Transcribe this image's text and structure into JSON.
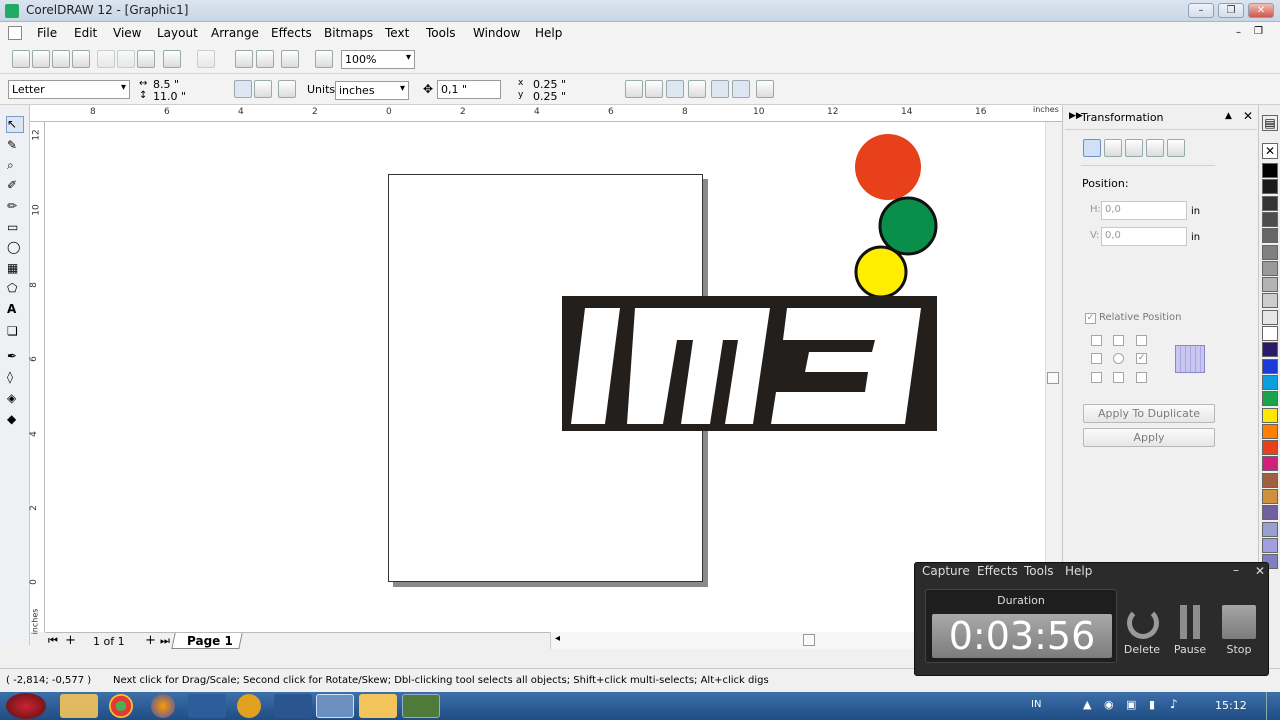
{
  "window": {
    "title": "CorelDRAW 12 - [Graphic1]"
  },
  "menubar": {
    "items": [
      "File",
      "Edit",
      "View",
      "Layout",
      "Arrange",
      "Effects",
      "Bitmaps",
      "Text",
      "Tools",
      "Window",
      "Help"
    ]
  },
  "toolbar1": {
    "zoom_value": "100%"
  },
  "property_bar": {
    "paper_type": "Letter",
    "page_width": "8.5 \"",
    "page_height": "11.0 \"",
    "units_label": "Units:",
    "units_value": "inches",
    "nudge_value": "0,1 \"",
    "duplicate_x": "0.25 \"",
    "duplicate_y": "0.25 \""
  },
  "rulers": {
    "top_labels": [
      "8",
      "6",
      "4",
      "2",
      "0",
      "2",
      "4",
      "6",
      "8",
      "10",
      "12",
      "14",
      "16"
    ],
    "top_unit": "inches",
    "left_labels": [
      "12",
      "10",
      "8",
      "6",
      "4",
      "2",
      "0"
    ],
    "left_unit": "inches"
  },
  "page_navigation": {
    "page_count_text": "1 of 1",
    "current_tab": "Page 1"
  },
  "logo": {
    "text": "IM3"
  },
  "traffic_lights": {
    "colors": [
      "#e8401a",
      "#0a8f4a",
      "#ffee00"
    ]
  },
  "docker": {
    "title": "Transformation",
    "section_label": "Position:",
    "h_label": "H:",
    "h_value": "0,0",
    "h_unit": "in",
    "v_label": "V:",
    "v_value": "0,0",
    "v_unit": "in",
    "relative_position_label": "Relative Position",
    "apply_duplicate_label": "Apply To Duplicate",
    "apply_label": "Apply"
  },
  "palette": {
    "colors": [
      "#000000",
      "#1a1a1a",
      "#333333",
      "#4d4d4d",
      "#666666",
      "#808080",
      "#999999",
      "#b3b3b3",
      "#cccccc",
      "#e6e6e6",
      "#ffffff",
      "#2b1a6b",
      "#1a3bd8",
      "#0aa0e0",
      "#1aa34a",
      "#ffe800",
      "#ff8000",
      "#e8401a",
      "#d0207a",
      "#a06040",
      "#d09040",
      "#7060a0",
      "#9aa0d0",
      "#a0a0e0",
      "#8080c0"
    ]
  },
  "statusbar": {
    "coordinates": "( -2,814; -0,577 )",
    "hint": "Next click for Drag/Scale; Second click for Rotate/Skew; Dbl-clicking tool selects all objects; Shift+click multi-selects; Alt+click digs"
  },
  "recorder": {
    "menu": [
      "Capture",
      "Effects",
      "Tools",
      "Help"
    ],
    "duration_label": "Duration",
    "time": "0:03:56",
    "delete_label": "Delete",
    "pause_label": "Pause",
    "stop_label": "Stop"
  },
  "taskbar": {
    "language": "IN",
    "clock": "15:12"
  }
}
